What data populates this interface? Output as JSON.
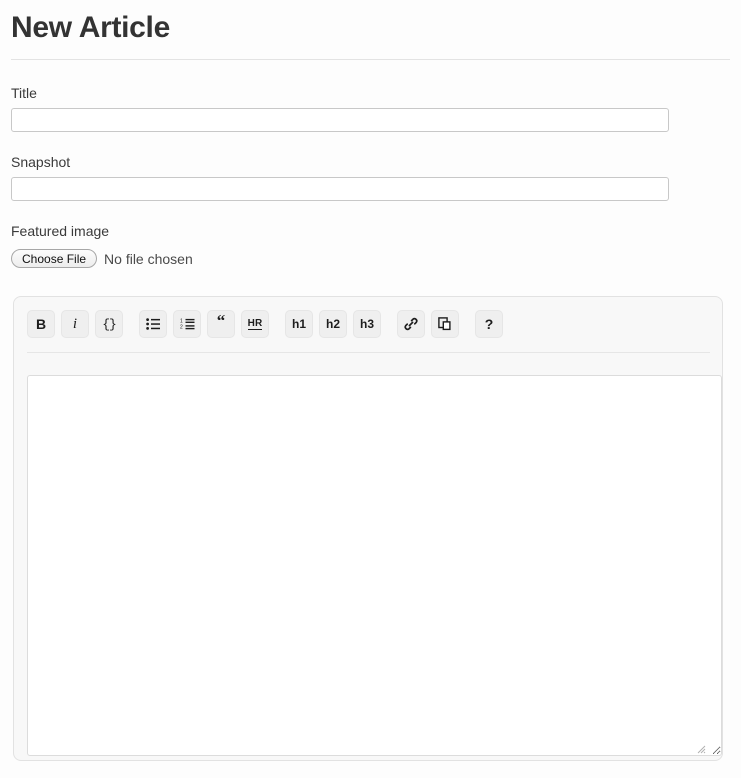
{
  "page": {
    "heading": "New Article"
  },
  "form": {
    "fields": [
      {
        "label": "Title",
        "value": "",
        "placeholder": ""
      },
      {
        "label": "Snapshot",
        "value": "",
        "placeholder": ""
      }
    ],
    "featured_image": {
      "label": "Featured image",
      "button_label": "Choose File",
      "status_text": "No file chosen"
    }
  },
  "editor": {
    "toolbar": [
      {
        "name": "bold",
        "label": "B",
        "icon": "bold-icon",
        "title": "Bold"
      },
      {
        "name": "italic",
        "label": "i",
        "icon": "italic-icon",
        "title": "Italic"
      },
      {
        "name": "code",
        "label": "{}",
        "icon": "code-icon",
        "title": "Code"
      },
      {
        "name": "unordered-list",
        "label": "",
        "icon": "bulleted-list-icon",
        "title": "Unordered list"
      },
      {
        "name": "ordered-list",
        "label": "",
        "icon": "numbered-list-icon",
        "title": "Ordered list"
      },
      {
        "name": "blockquote",
        "label": "“",
        "icon": "quote-icon",
        "title": "Quote"
      },
      {
        "name": "horizontal-rule",
        "label": "HR",
        "icon": "horizontal-rule-icon",
        "title": "Horizontal rule"
      },
      {
        "name": "heading-1",
        "label": "h1",
        "icon": "heading-1-icon",
        "title": "Heading 1"
      },
      {
        "name": "heading-2",
        "label": "h2",
        "icon": "heading-2-icon",
        "title": "Heading 2"
      },
      {
        "name": "heading-3",
        "label": "h3",
        "icon": "heading-3-icon",
        "title": "Heading 3"
      },
      {
        "name": "link",
        "label": "",
        "icon": "link-icon",
        "title": "Link"
      },
      {
        "name": "duplicate",
        "label": "",
        "icon": "copy-icon",
        "title": "Duplicate"
      },
      {
        "name": "help",
        "label": "?",
        "icon": "help-icon",
        "title": "Help"
      }
    ],
    "body": {
      "value": "",
      "placeholder": ""
    }
  },
  "colors": {
    "page_background": "#fdfdfd",
    "panel_background": "#f8f8f8",
    "panel_border": "#e2e2e2",
    "input_border": "#c8c8c8",
    "toolbar_button_background": "#efefef",
    "text": "#333333",
    "rule": "#e3e3e3"
  }
}
